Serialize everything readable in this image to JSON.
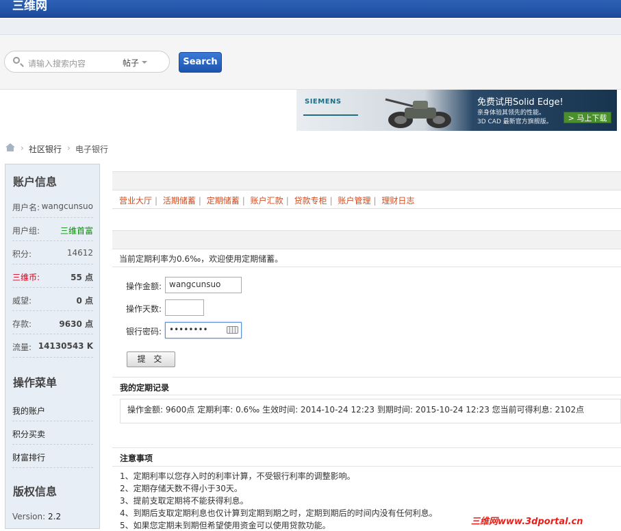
{
  "header": {
    "site_title": "三维网"
  },
  "search": {
    "placeholder": "请输入搜索内容",
    "category": "帖子",
    "button": "Search"
  },
  "ad": {
    "brand": "SIEMENS",
    "title": "免费试用Solid Edge!",
    "line1": "亲身体验其领先的性能。",
    "line2": "3D CAD 最新官方旗舰版。",
    "button": "> 马上下载"
  },
  "breadcrumb": {
    "level1": "社区银行",
    "level2": "电子银行"
  },
  "sidebar": {
    "account_title": "账户信息",
    "rows": [
      {
        "label": "用户名:",
        "value": "wangcunsuo"
      },
      {
        "label": "用户组:",
        "value": "三维首富"
      },
      {
        "label": "积分:",
        "value": "14612"
      },
      {
        "label": "三维币:",
        "value": "55 点"
      },
      {
        "label": "威望:",
        "value": "0 点"
      },
      {
        "label": "存款:",
        "value": "9630 点"
      },
      {
        "label": "流量:",
        "value": "14130543 K"
      }
    ],
    "menu_title": "操作菜单",
    "menu": [
      "我的账户",
      "积分买卖",
      "财富排行"
    ],
    "copyright_title": "版权信息",
    "version_label": "Version:",
    "version": "2.2"
  },
  "tabs": [
    "营业大厅",
    "活期储蓄",
    "定期储蓄",
    "账户汇款",
    "贷款专柜",
    "账户管理",
    "理财日志"
  ],
  "intro": "当前定期利率为0.6‰，欢迎使用定期储蓄。",
  "form": {
    "amount_label": "操作金额:",
    "amount_value": "wangcunsuo",
    "days_label": "操作天数:",
    "days_value": "",
    "password_label": "银行密码:",
    "password_value": "••••••••",
    "submit": "提 交"
  },
  "records": {
    "title": "我的定期记录",
    "row": "操作金额: 9600点   定期利率: 0.6‰   生效时间: 2014-10-24 12:23   到期时间: 2015-10-24 12:23   您当前可得利息: 2102点"
  },
  "notes": {
    "title": "注意事项",
    "items": [
      "1、定期利率以您存入时的利率计算，不受银行利率的调整影响。",
      "2、定期存储天数不得小于30天。",
      "3、提前支取定期将不能获得利息。",
      "4、到期后支取定期利息也仅计算到定期到期之时，定期到期后的时间内没有任何利息。",
      "5、如果您定期未到期但希望使用资金可以使用贷款功能。"
    ]
  },
  "watermark": "三维网www.3dportal.cn",
  "colors": {
    "header_blue": "#1f4fa3",
    "tab_link": "#d14b1f",
    "group_green": "#0a8a0a",
    "coin_red": "#d2001a"
  }
}
